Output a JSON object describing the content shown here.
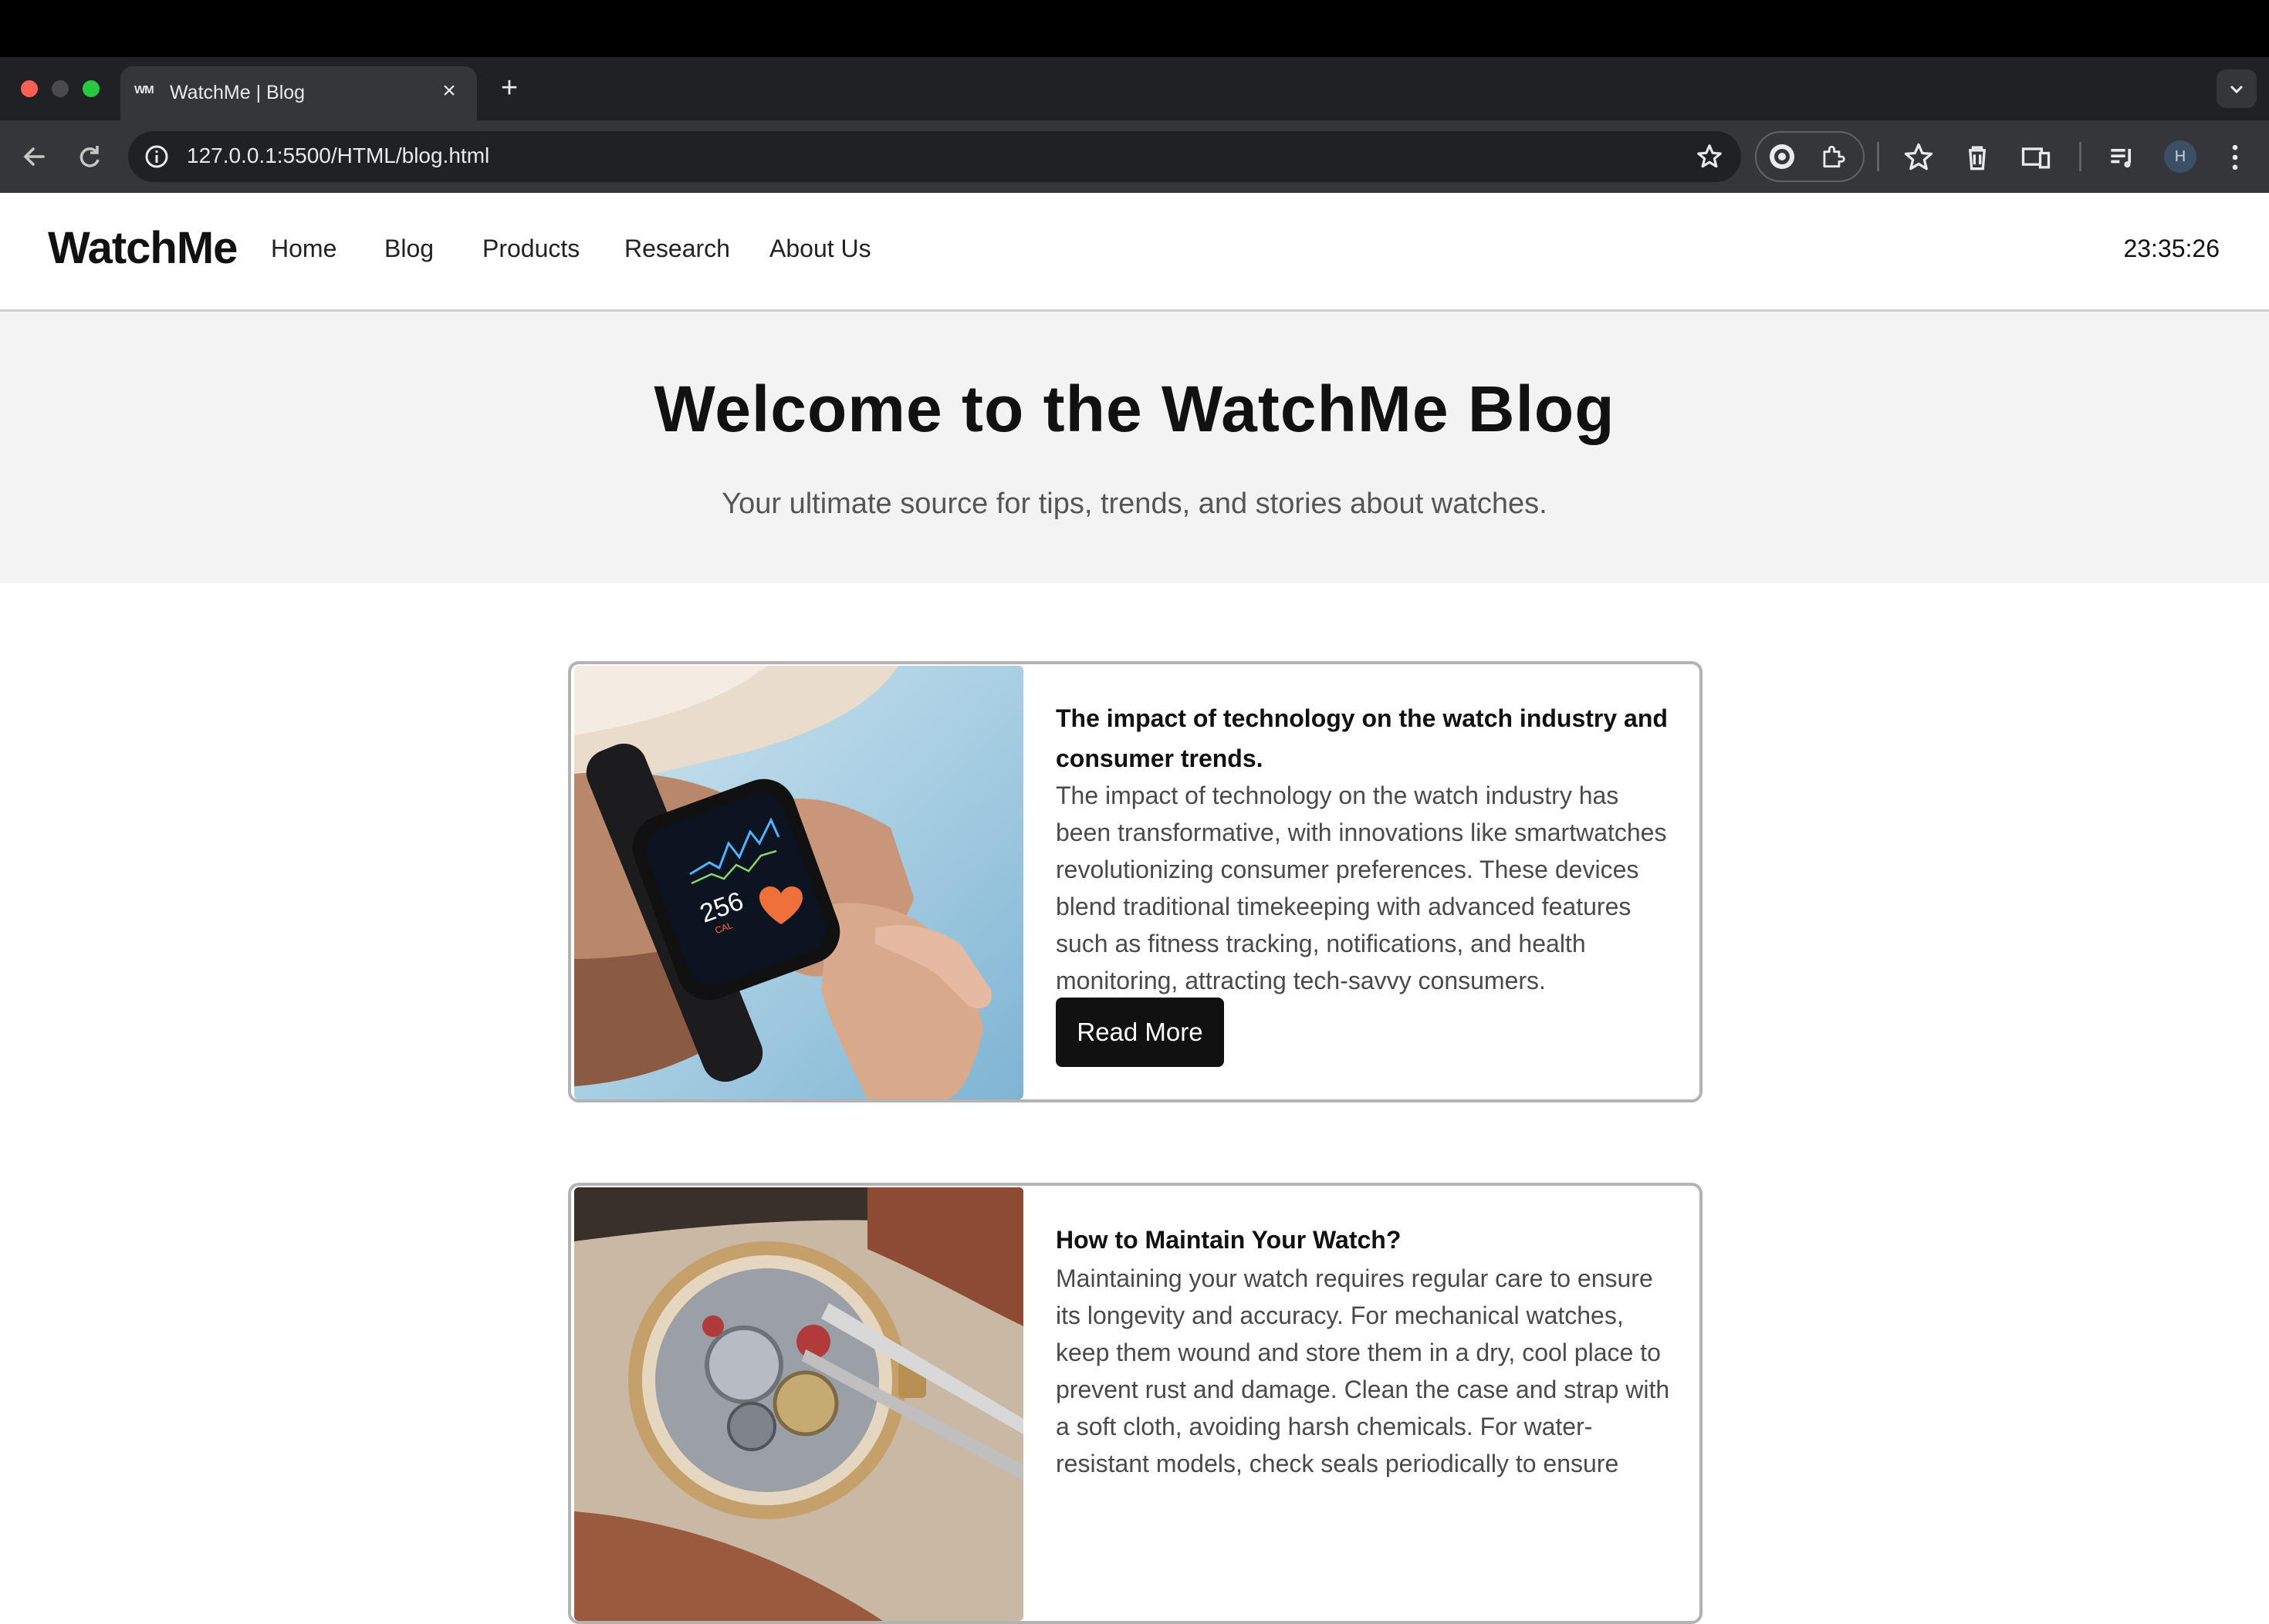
{
  "browser": {
    "tab_favicon": "WM",
    "tab_title": "WatchMe | Blog",
    "new_tab": "+",
    "tab_close": "×",
    "url": "127.0.0.1:5500/HTML/blog.html",
    "profile_initial": "H"
  },
  "site": {
    "logo": "WatchMe",
    "nav": [
      {
        "label": "Home"
      },
      {
        "label": "Blog"
      },
      {
        "label": "Products"
      },
      {
        "label": "Research"
      },
      {
        "label": "About Us"
      }
    ],
    "clock": "23:35:26"
  },
  "hero": {
    "title": "Welcome to the WatchMe Blog",
    "subtitle": "Your ultimate source for tips, trends, and stories about watches."
  },
  "posts": [
    {
      "title": "The impact of technology on the watch industry and consumer trends.",
      "excerpt": "The impact of technology on the watch industry has been transformative, with innovations like smartwatches revolutionizing consumer preferences. These devices blend traditional timekeeping with advanced features such as fitness tracking, notifications, and health monitoring, attracting tech-savvy consumers.",
      "button": "Read More",
      "image_icon": "smartwatch-photo",
      "watch_reading": "256",
      "watch_unit": "CAL"
    },
    {
      "title": "How to Maintain Your Watch?",
      "excerpt": "Maintaining your watch requires regular care to ensure its longevity and accuracy. For mechanical watches, keep them wound and store them in a dry, cool place to prevent rust and damage. Clean the case and strap with a soft cloth, avoiding harsh chemicals. For water-resistant models, check seals periodically to ensure",
      "image_icon": "watch-repair-photo"
    }
  ]
}
